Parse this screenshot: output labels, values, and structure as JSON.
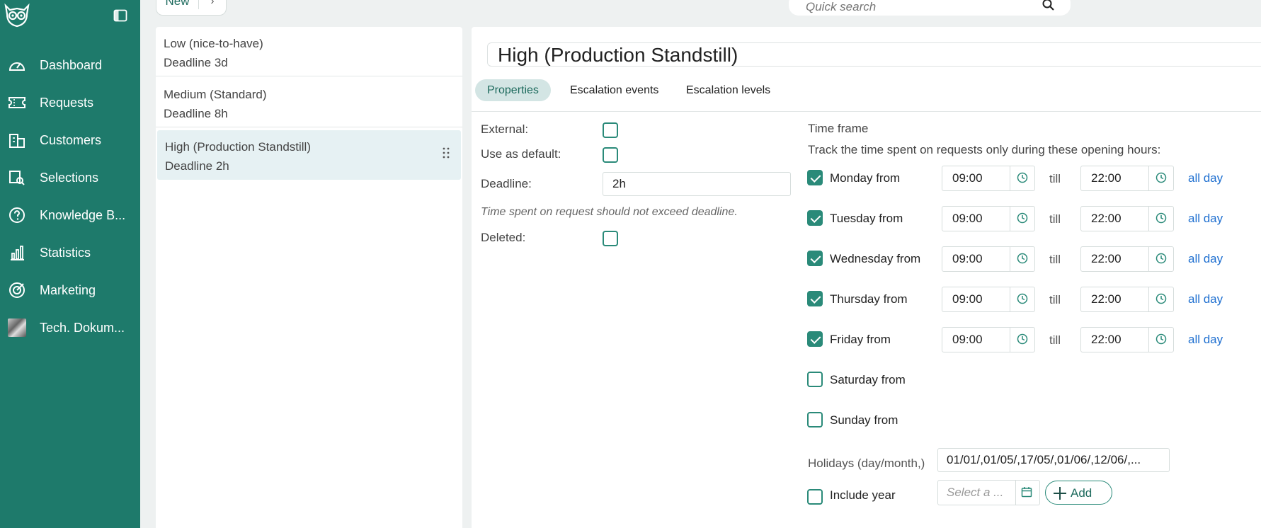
{
  "sidebar": {
    "items": [
      {
        "label": "Dashboard",
        "icon": "dashboard-icon"
      },
      {
        "label": "Requests",
        "icon": "ticket-icon"
      },
      {
        "label": "Customers",
        "icon": "building-icon"
      },
      {
        "label": "Selections",
        "icon": "selections-icon"
      },
      {
        "label": "Knowledge B...",
        "icon": "question-icon"
      },
      {
        "label": "Statistics",
        "icon": "bar-chart-icon"
      },
      {
        "label": "Marketing",
        "icon": "target-icon"
      },
      {
        "label": "Tech. Dokum...",
        "icon": "thumbnail-image"
      }
    ]
  },
  "topbar": {
    "new_label": "New",
    "arrow": "›",
    "search_placeholder": "Quick search"
  },
  "list": {
    "items": [
      {
        "name": "Low (nice-to-have)",
        "deadline": "Deadline 3d"
      },
      {
        "name": "Medium (Standard)",
        "deadline": "Deadline 8h"
      },
      {
        "name": "High (Production Standstill)",
        "deadline": "Deadline 2h"
      }
    ]
  },
  "detail": {
    "title": "High (Production Standstill)",
    "tabs": [
      "Properties",
      "Escalation events",
      "Escalation levels"
    ],
    "properties": {
      "external_label": "External:",
      "default_label": "Use as default:",
      "deadline_label": "Deadline:",
      "deadline_value": "2h",
      "hint": "Time spent on request should not exceed deadline.",
      "deleted_label": "Deleted:"
    },
    "timeframe": {
      "title": "Time frame",
      "subtitle": "Track the time spent on requests only during these opening hours:",
      "till": "till",
      "all_day": "all day",
      "days": [
        {
          "label": "Monday from",
          "checked": true,
          "from": "09:00",
          "to": "22:00"
        },
        {
          "label": "Tuesday from",
          "checked": true,
          "from": "09:00",
          "to": "22:00"
        },
        {
          "label": "Wednesday from",
          "checked": true,
          "from": "09:00",
          "to": "22:00"
        },
        {
          "label": "Thursday from",
          "checked": true,
          "from": "09:00",
          "to": "22:00"
        },
        {
          "label": "Friday from",
          "checked": true,
          "from": "09:00",
          "to": "22:00"
        },
        {
          "label": "Saturday from",
          "checked": false
        },
        {
          "label": "Sunday from",
          "checked": false
        }
      ],
      "holidays_label": "Holidays (day/month,)",
      "holidays_value": "01/01/,01/05/,17/05/,01/06/,12/06/,...",
      "include_year_label": "Include year",
      "date_placeholder": "Select a ...",
      "add_label": "Add"
    }
  },
  "colors": {
    "sidebar": "#1e7a6b",
    "accent": "#2a8a79",
    "link": "#1e6fd0",
    "selected": "#e6f1f3"
  }
}
